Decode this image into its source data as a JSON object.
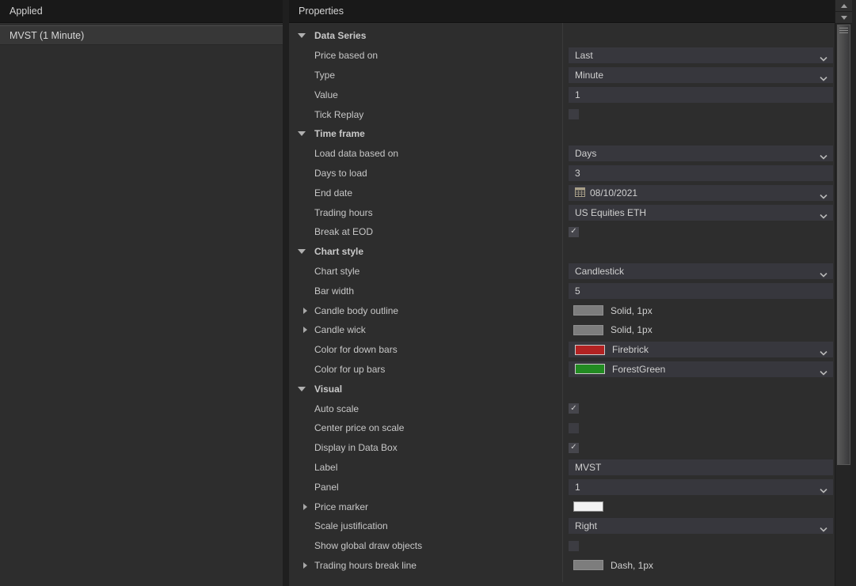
{
  "left_panel": {
    "header": "Applied",
    "items": [
      {
        "label": "MVST (1 Minute)"
      }
    ]
  },
  "right_panel": {
    "header": "Properties",
    "rows": [
      {
        "type": "section",
        "label": "Data Series"
      },
      {
        "type": "combo",
        "label": "Price based on",
        "value": "Last"
      },
      {
        "type": "combo",
        "label": "Type",
        "value": "Minute"
      },
      {
        "type": "text",
        "label": "Value",
        "value": "1"
      },
      {
        "type": "checkbox",
        "label": "Tick Replay",
        "checked": false
      },
      {
        "type": "section",
        "label": "Time frame"
      },
      {
        "type": "combo",
        "label": "Load data based on",
        "value": "Days"
      },
      {
        "type": "text",
        "label": "Days to load",
        "value": "3"
      },
      {
        "type": "datecombo",
        "label": "End date",
        "value": "08/10/2021"
      },
      {
        "type": "combo",
        "label": "Trading hours",
        "value": "US Equities ETH"
      },
      {
        "type": "checkbox",
        "label": "Break at EOD",
        "checked": true
      },
      {
        "type": "section",
        "label": "Chart style"
      },
      {
        "type": "combo",
        "label": "Chart style",
        "value": "Candlestick"
      },
      {
        "type": "text",
        "label": "Bar width",
        "value": "5"
      },
      {
        "type": "linestyle",
        "label": "Candle body outline",
        "value": "Solid, 1px",
        "swatch": "#7d7d7d",
        "expander": true
      },
      {
        "type": "linestyle",
        "label": "Candle wick",
        "value": "Solid, 1px",
        "swatch": "#7d7d7d",
        "expander": true
      },
      {
        "type": "colorcombo",
        "label": "Color for down bars",
        "value": "Firebrick",
        "swatch": "#B22222"
      },
      {
        "type": "colorcombo",
        "label": "Color for up bars",
        "value": "ForestGreen",
        "swatch": "#228B22"
      },
      {
        "type": "section",
        "label": "Visual"
      },
      {
        "type": "checkbox",
        "label": "Auto scale",
        "checked": true
      },
      {
        "type": "checkbox",
        "label": "Center price on scale",
        "checked": false
      },
      {
        "type": "checkbox",
        "label": "Display in Data Box",
        "checked": true
      },
      {
        "type": "text",
        "label": "Label",
        "value": "MVST"
      },
      {
        "type": "combo",
        "label": "Panel",
        "value": "1"
      },
      {
        "type": "swatchonly",
        "label": "Price marker",
        "swatch": "#f2f2f2",
        "expander": true
      },
      {
        "type": "combo",
        "label": "Scale justification",
        "value": "Right"
      },
      {
        "type": "checkbox",
        "label": "Show global draw objects",
        "checked": false
      },
      {
        "type": "linestyle",
        "label": "Trading hours break line",
        "value": "Dash, 1px",
        "swatch": "#7d7d7d",
        "expander": true
      }
    ]
  },
  "glyphs": {
    "check": "✓"
  },
  "colors": {
    "firebrick": "#B22222",
    "forestgreen": "#228B22",
    "line_swatch_gray": "#7d7d7d",
    "price_marker_white": "#f2f2f2",
    "field_background": "#37373d",
    "panel_background": "#2d2d2d",
    "header_background": "#191919"
  }
}
